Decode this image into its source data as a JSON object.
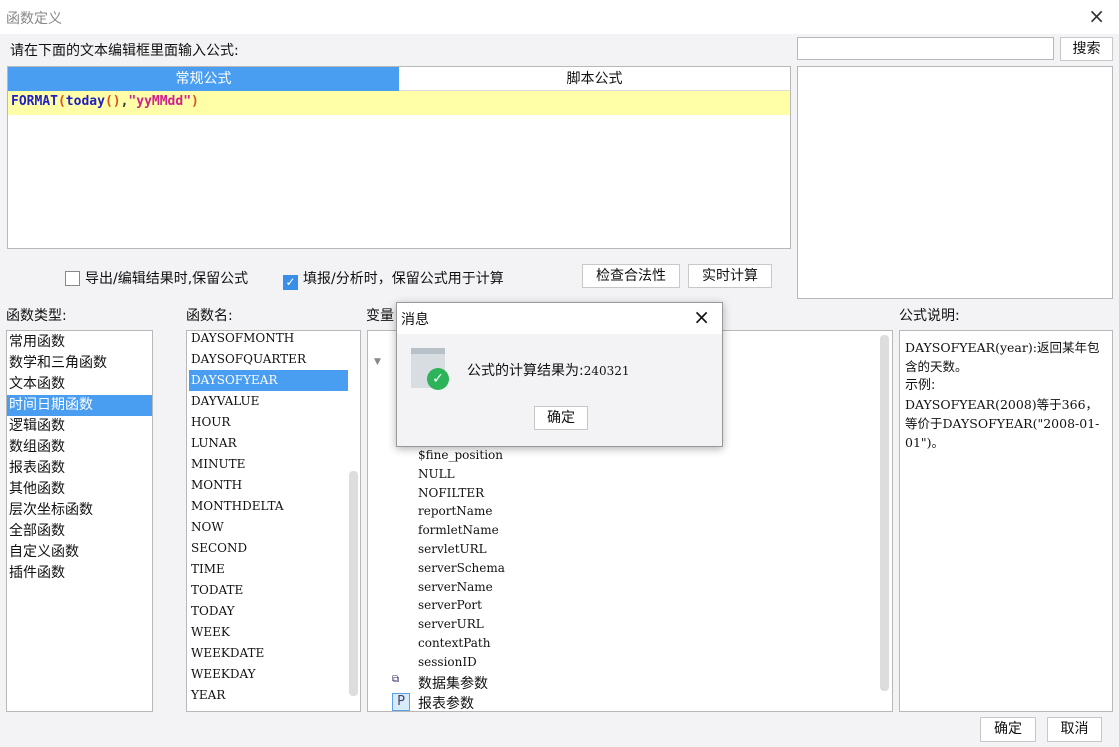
{
  "window": {
    "title": "函数定义",
    "close": "×"
  },
  "editor": {
    "prompt": "请在下面的文本编辑框里面输入公式:",
    "tabs": [
      "常规公式",
      "脚本公式"
    ],
    "formula": {
      "fn": "FORMAT",
      "p1": "(",
      "arg": "today",
      "p2": "()",
      ",": ",",
      "str": "\"yyMMdd\"",
      "p3": ")"
    }
  },
  "search": {
    "value": "",
    "button": "搜索"
  },
  "options": {
    "keep_formula_export": "导出/编辑结果时,保留公式",
    "keep_formula_fill": "填报/分析时，保留公式用于计算",
    "check_button": "检查合法性",
    "realtime_button": "实时计算"
  },
  "labels": {
    "types": "函数类型:",
    "names": "函数名:",
    "vars": "变量",
    "desc": "公式说明:"
  },
  "types": [
    "常用函数",
    "数学和三角函数",
    "文本函数",
    "时间日期函数",
    "逻辑函数",
    "数组函数",
    "报表函数",
    "其他函数",
    "层次坐标函数",
    "全部函数",
    "自定义函数",
    "插件函数"
  ],
  "names": [
    "DAYSOFMONTH",
    "DAYSOFQUARTER",
    "DAYSOFYEAR",
    "DAYVALUE",
    "HOUR",
    "LUNAR",
    "MINUTE",
    "MONTH",
    "MONTHDELTA",
    "NOW",
    "SECOND",
    "TIME",
    "TODATE",
    "TODAY",
    "WEEK",
    "WEEKDATE",
    "WEEKDAY",
    "YEAR"
  ],
  "vars": [
    "$fine_position",
    "NULL",
    "NOFILTER",
    "reportName",
    "formletName",
    "servletURL",
    "serverSchema",
    "serverName",
    "serverPort",
    "serverURL",
    "contextPath",
    "sessionID"
  ],
  "var_groups": [
    "数据集参数",
    "报表参数"
  ],
  "description": [
    "DAYSOFYEAR(year):返回某年包含的天数。",
    "示例:",
    "DAYSOFYEAR(2008)等于366，等价于DAYSOFYEAR(\"2008-01-01\")。"
  ],
  "footer": {
    "ok": "确定",
    "cancel": "取消"
  },
  "dialog": {
    "title": "消息",
    "message": "公式的计算结果为:",
    "result": "240321",
    "ok": "确定",
    "close": "×"
  }
}
